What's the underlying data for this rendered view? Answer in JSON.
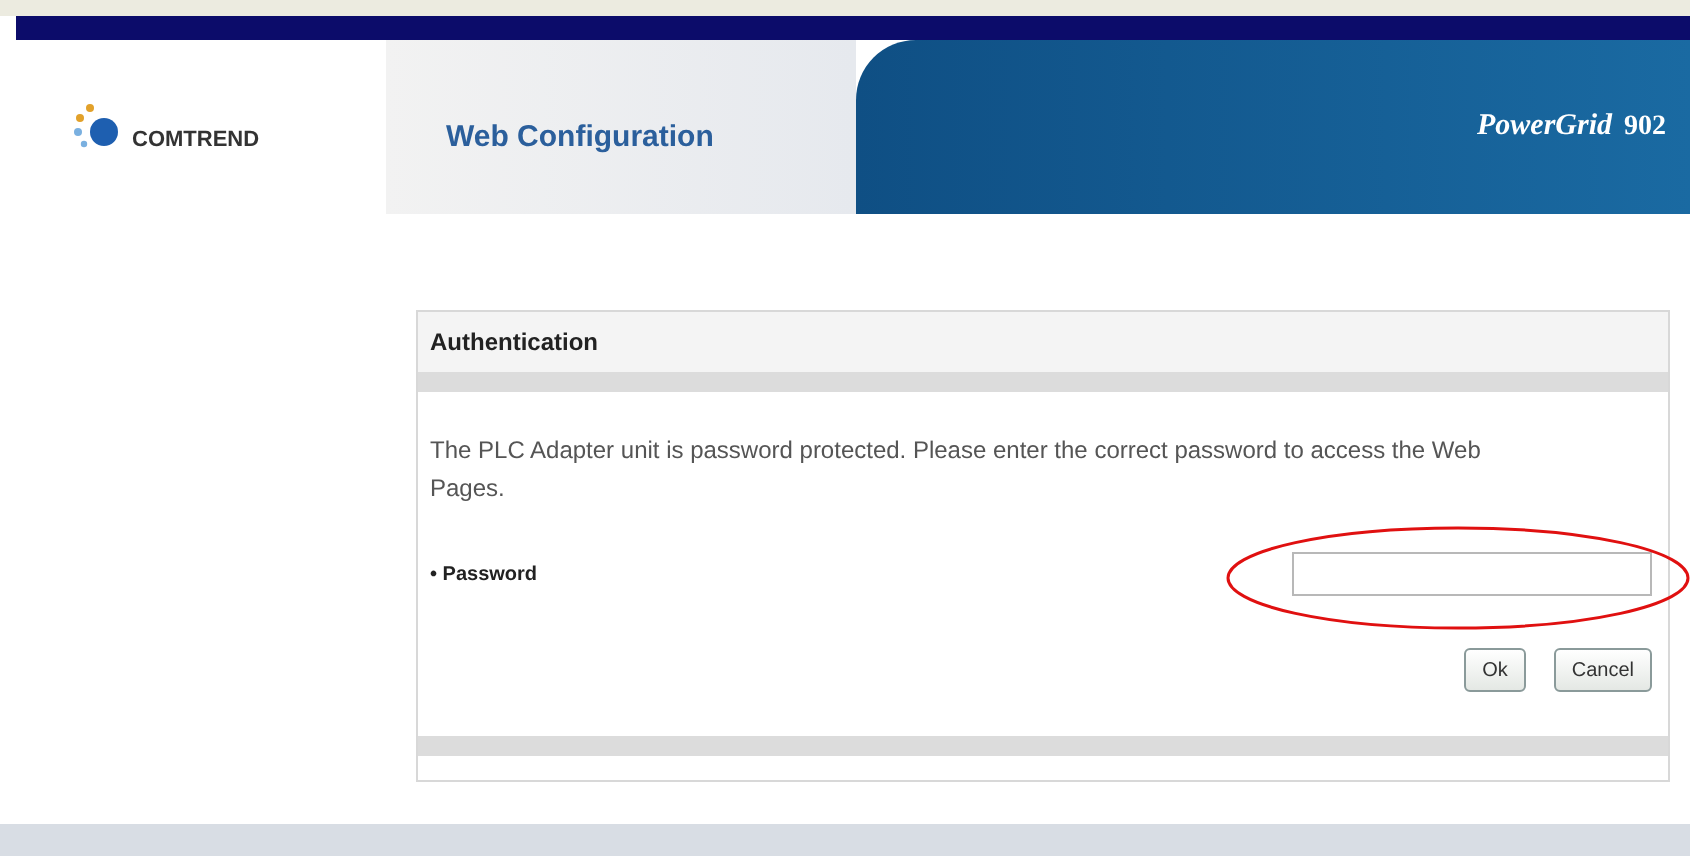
{
  "header": {
    "brand": "COMTREND",
    "title": "Web Configuration",
    "product": "PowerGrid",
    "model": "902"
  },
  "panel": {
    "title": "Authentication",
    "message": "The PLC Adapter unit is password protected. Please enter the correct password to access the Web Pages.",
    "field_label": "Password",
    "field_bullet": "•",
    "buttons": [
      "Ok",
      "Cancel"
    ]
  }
}
